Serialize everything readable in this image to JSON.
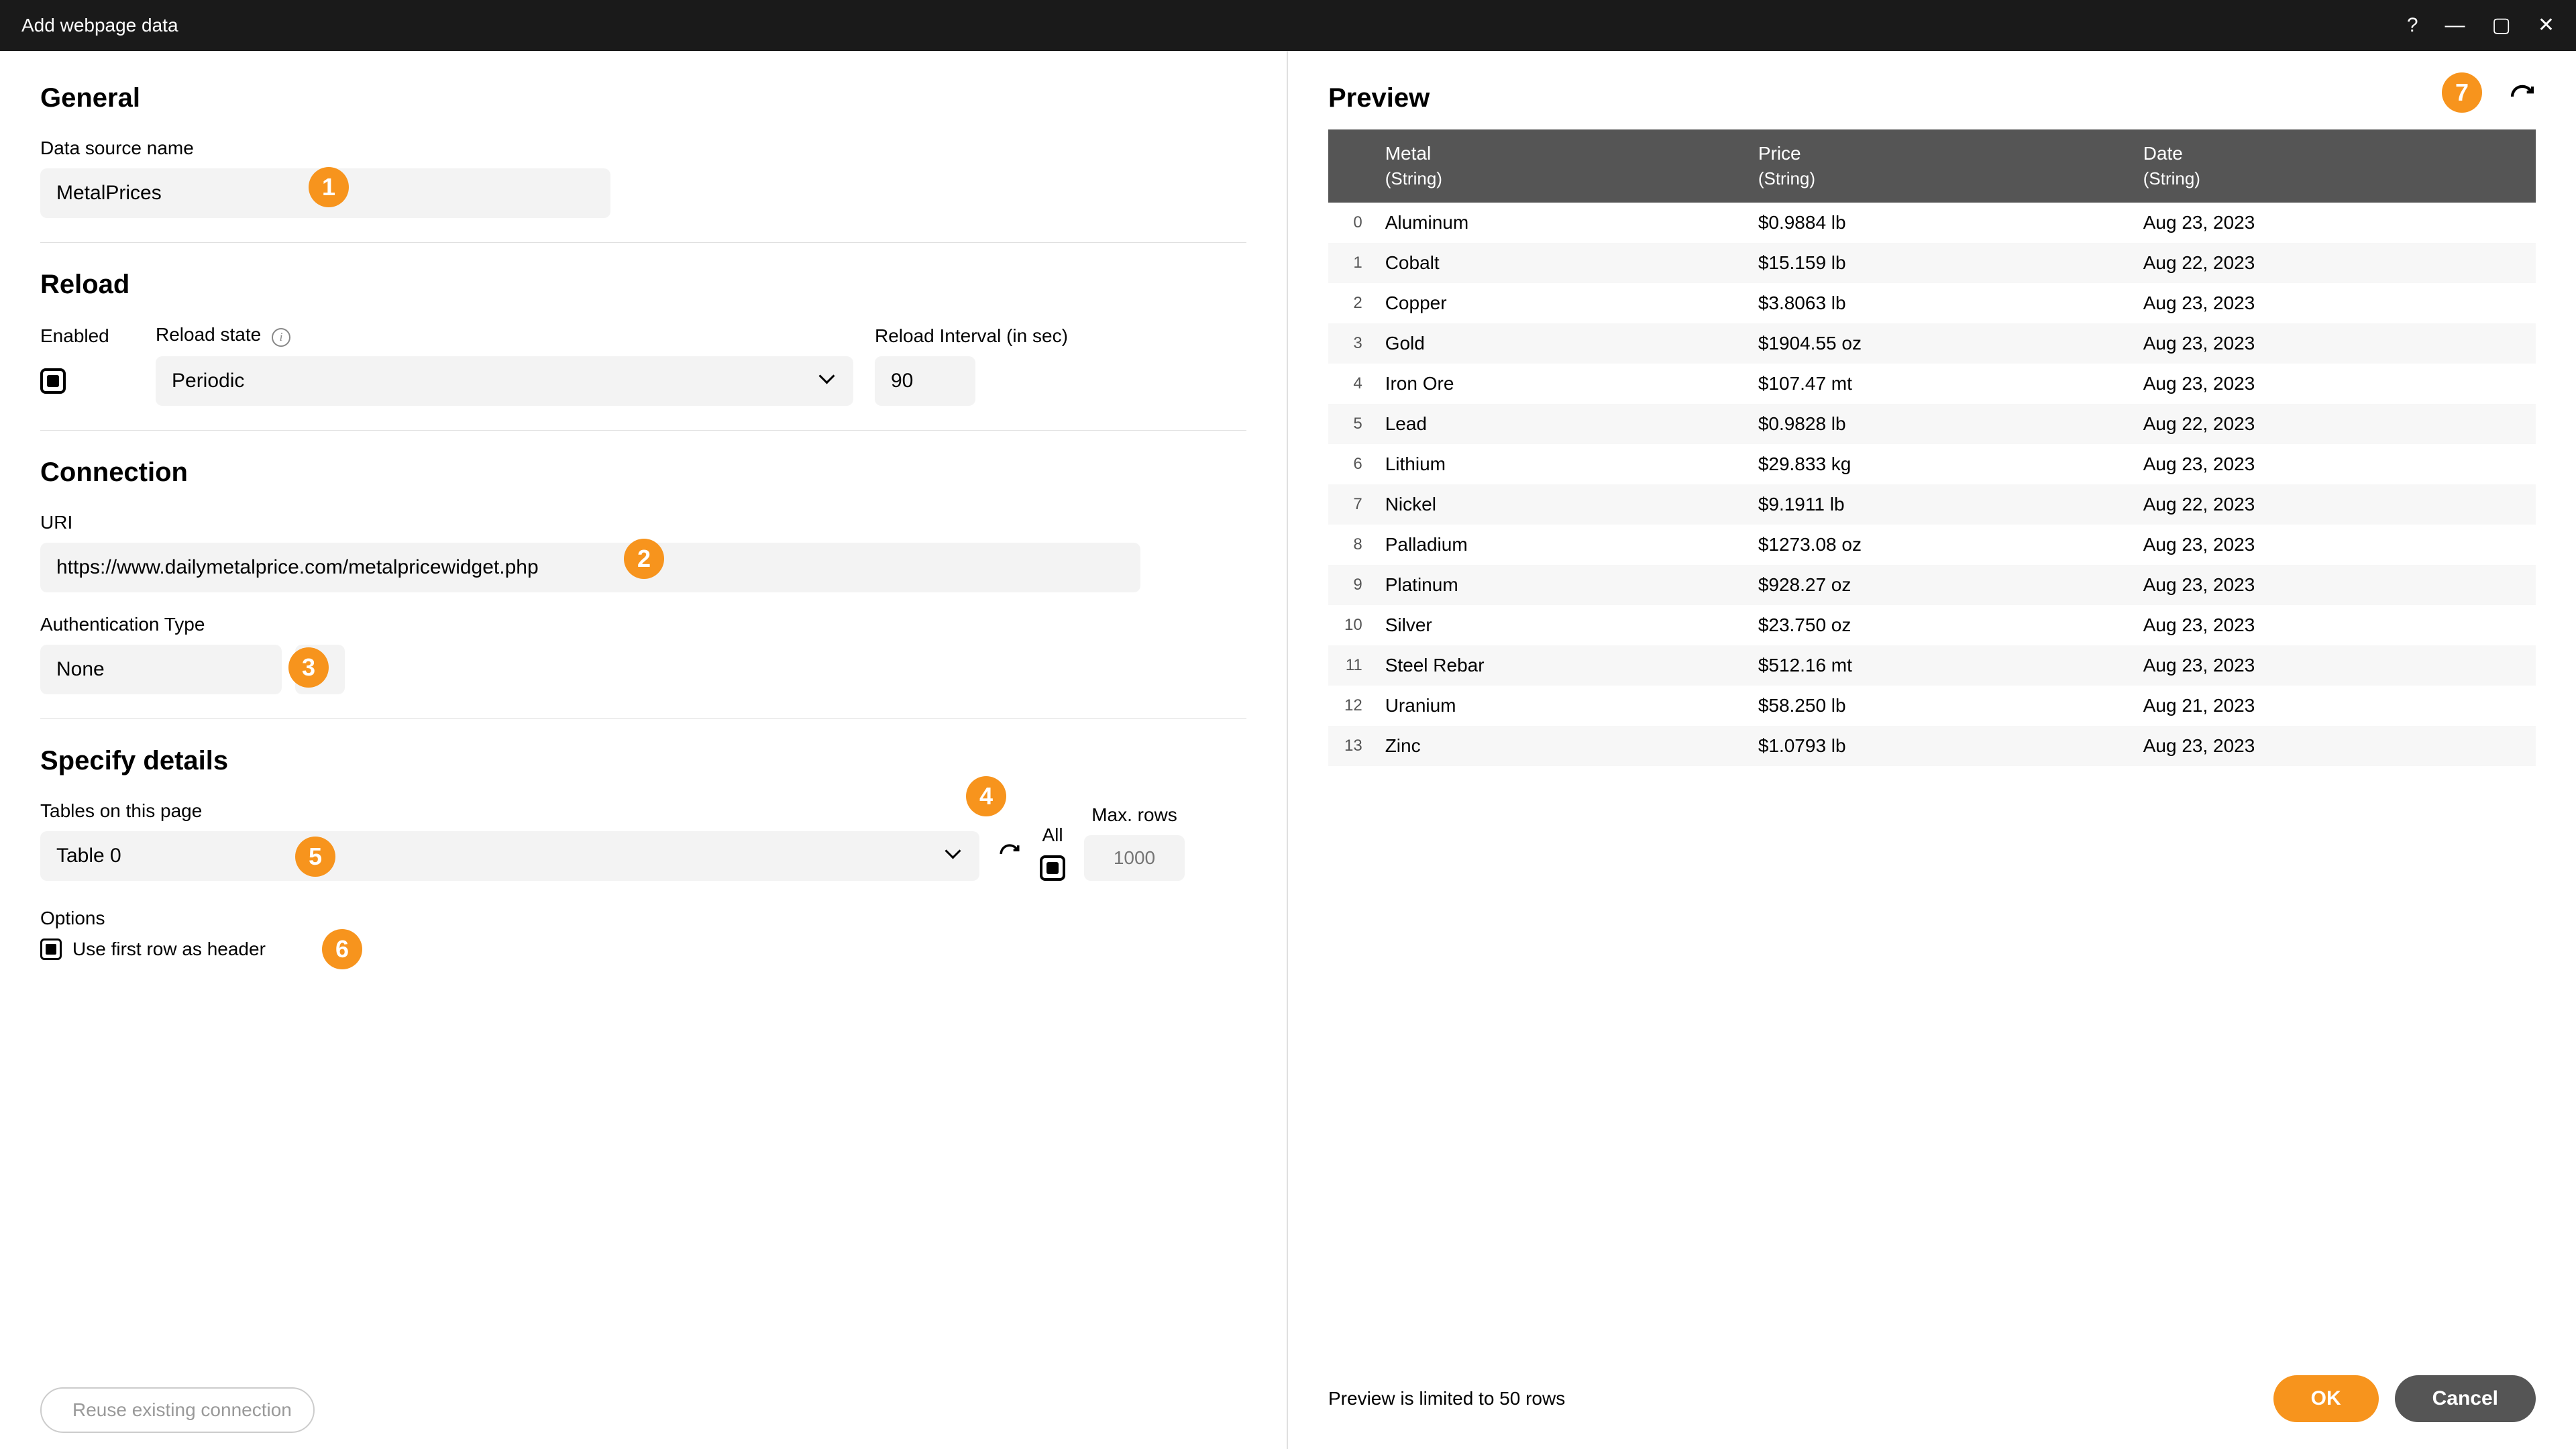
{
  "titlebar": {
    "title": "Add webpage data"
  },
  "general": {
    "heading": "General",
    "data_source_name_label": "Data source name",
    "data_source_name_value": "MetalPrices"
  },
  "reload": {
    "heading": "Reload",
    "enabled_label": "Enabled",
    "reload_state_label": "Reload state",
    "reload_state_value": "Periodic",
    "reload_interval_label": "Reload Interval (in sec)",
    "reload_interval_value": "90"
  },
  "connection": {
    "heading": "Connection",
    "uri_label": "URI",
    "uri_value": "https://www.dailymetalprice.com/metalpricewidget.php",
    "auth_type_label": "Authentication Type",
    "auth_type_value": "None"
  },
  "specify": {
    "heading": "Specify details",
    "tables_label": "Tables on this page",
    "tables_value": "Table 0",
    "all_label": "All",
    "maxrows_label": "Max. rows",
    "maxrows_placeholder": "1000",
    "options_label": "Options",
    "first_row_header_label": "Use first row as header"
  },
  "reuse_label": "Reuse existing connection",
  "preview": {
    "heading": "Preview",
    "columns": [
      {
        "name": "Metal",
        "type": "(String)"
      },
      {
        "name": "Price",
        "type": "(String)"
      },
      {
        "name": "Date",
        "type": "(String)"
      }
    ],
    "rows": [
      {
        "metal": "Aluminum",
        "price": "$0.9884 lb",
        "date": "Aug 23, 2023"
      },
      {
        "metal": "Cobalt",
        "price": "$15.159 lb",
        "date": "Aug 22, 2023"
      },
      {
        "metal": "Copper",
        "price": "$3.8063 lb",
        "date": "Aug 23, 2023"
      },
      {
        "metal": "Gold",
        "price": "$1904.55 oz",
        "date": "Aug 23, 2023"
      },
      {
        "metal": "Iron Ore",
        "price": "$107.47 mt",
        "date": "Aug 23, 2023"
      },
      {
        "metal": "Lead",
        "price": "$0.9828 lb",
        "date": "Aug 22, 2023"
      },
      {
        "metal": "Lithium",
        "price": "$29.833 kg",
        "date": "Aug 23, 2023"
      },
      {
        "metal": "Nickel",
        "price": "$9.1911 lb",
        "date": "Aug 22, 2023"
      },
      {
        "metal": "Palladium",
        "price": "$1273.08 oz",
        "date": "Aug 23, 2023"
      },
      {
        "metal": "Platinum",
        "price": "$928.27 oz",
        "date": "Aug 23, 2023"
      },
      {
        "metal": "Silver",
        "price": "$23.750 oz",
        "date": "Aug 23, 2023"
      },
      {
        "metal": "Steel Rebar",
        "price": "$512.16 mt",
        "date": "Aug 23, 2023"
      },
      {
        "metal": "Uranium",
        "price": "$58.250 lb",
        "date": "Aug 21, 2023"
      },
      {
        "metal": "Zinc",
        "price": "$1.0793 lb",
        "date": "Aug 23, 2023"
      }
    ],
    "footer_note": "Preview is limited to 50 rows"
  },
  "buttons": {
    "ok": "OK",
    "cancel": "Cancel"
  },
  "badges": {
    "b1": "1",
    "b2": "2",
    "b3": "3",
    "b4": "4",
    "b5": "5",
    "b6": "6",
    "b7": "7"
  }
}
